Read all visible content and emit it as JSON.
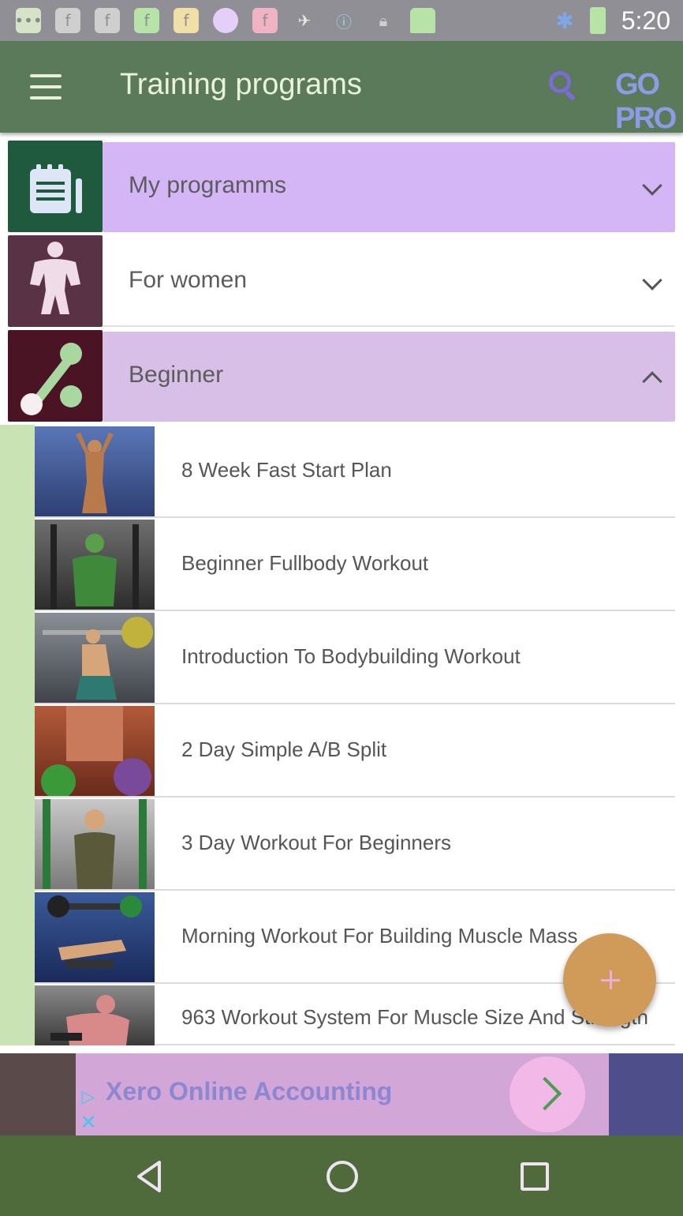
{
  "status_bar": {
    "time": "5:20",
    "icons": [
      "messages-icon",
      "facebook-icon",
      "facebook-icon",
      "facebook-icon",
      "facebook-icon",
      "circle-icon",
      "flipboard-icon",
      "fake-gps-icon",
      "info-icon",
      "lock-icon",
      "android-icon",
      "bluetooth-icon",
      "battery-icon"
    ]
  },
  "app_bar": {
    "title": "Training programs",
    "pro_label": "GO PRO"
  },
  "categories": [
    {
      "label": "My programms",
      "expanded": false,
      "panel_color": "#d4b6f7",
      "thumb_color": "#1f5a3e"
    },
    {
      "label": "For women",
      "expanded": false,
      "panel_color": "#ffffff",
      "thumb_color": "#5a3246"
    },
    {
      "label": "Beginner",
      "expanded": true,
      "panel_color": "#d7bfe8",
      "thumb_color": "#4a1424"
    }
  ],
  "programs": [
    {
      "label": "8 Week Fast Start Plan"
    },
    {
      "label": "Beginner Fullbody Workout"
    },
    {
      "label": "Introduction To Bodybuilding Workout"
    },
    {
      "label": "2 Day Simple A/B Split"
    },
    {
      "label": "3 Day Workout For Beginners"
    },
    {
      "label": "Morning Workout For Building Muscle Mass"
    },
    {
      "label": "963 Workout System For Muscle Size And Strength"
    }
  ],
  "ad": {
    "text": "Xero Online Accounting"
  },
  "colors": {
    "app_bar": "#5b7a5a",
    "fab": "#d09a58",
    "nav_bar": "#4f6b3c"
  }
}
